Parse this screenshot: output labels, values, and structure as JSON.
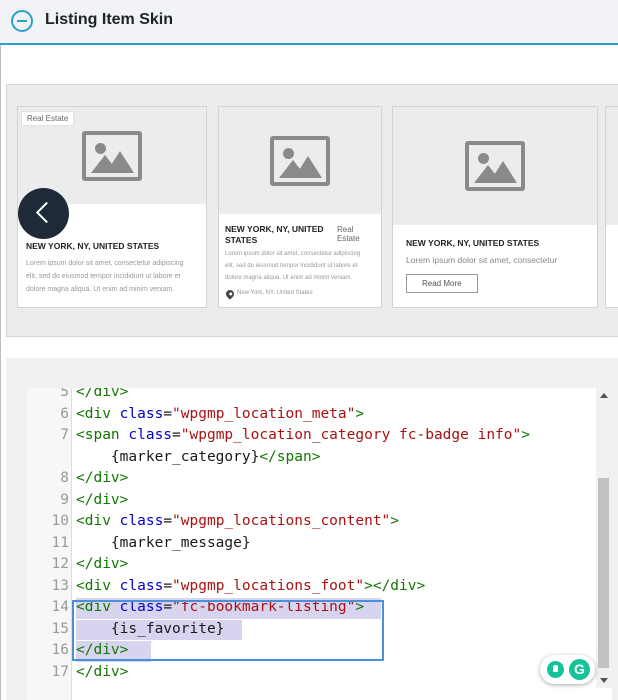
{
  "panel": {
    "title": "Listing Item Skin"
  },
  "cards": [
    {
      "badge": "Real Estate",
      "title": "NEW YORK, NY, UNITED STATES",
      "text": [
        "Lorem ipsum dolor sit amet, consectetur adipiscing",
        "elit, sed do eiusmod tempor incididunt ut labore et",
        "dolore magna aliqua. Ut enim ad minim veniam."
      ]
    },
    {
      "title_lines": [
        "NEW YORK, NY, UNITED",
        "STATES"
      ],
      "badge": "Real Estate",
      "text": [
        "Lorem ipsum dolor sit amet, consectetur adipiscing",
        "elit, sed do eiusmod tempor incididunt ut labore et",
        "dolore magna aliqua. Ut enim ad minim veniam."
      ],
      "location": "New York, NY, United States"
    },
    {
      "title": "NEW YORK, NY, UNITED STATES",
      "text": "Lorem ipsum dolor sit amet, consectetur",
      "button": "Read More"
    }
  ],
  "editor": {
    "lines": [
      {
        "num": "5",
        "tokens": [
          [
            "tag",
            "</div>"
          ]
        ]
      },
      {
        "num": "6",
        "tokens": [
          [
            "tag",
            "<div "
          ],
          [
            "attr",
            "class"
          ],
          [
            "txt",
            "="
          ],
          [
            "str",
            "\"wpgmp_location_meta\""
          ],
          [
            "tag",
            ">"
          ]
        ]
      },
      {
        "num": "7",
        "tokens": [
          [
            "tag",
            "<span "
          ],
          [
            "attr",
            "class"
          ],
          [
            "txt",
            "="
          ],
          [
            "str",
            "\"wpgmp_location_category fc-badge info\""
          ],
          [
            "tag",
            ">"
          ]
        ]
      },
      {
        "num": "",
        "tokens": [
          [
            "txt",
            "    {marker_category}"
          ],
          [
            "tag",
            "</span>"
          ]
        ]
      },
      {
        "num": "8",
        "tokens": [
          [
            "tag",
            "</div>"
          ]
        ]
      },
      {
        "num": "9",
        "tokens": [
          [
            "tag",
            "</div>"
          ]
        ]
      },
      {
        "num": "10",
        "tokens": [
          [
            "tag",
            "<div "
          ],
          [
            "attr",
            "class"
          ],
          [
            "txt",
            "="
          ],
          [
            "str",
            "\"wpgmp_locations_content\""
          ],
          [
            "tag",
            ">"
          ]
        ]
      },
      {
        "num": "11",
        "tokens": [
          [
            "txt",
            "    {marker_message}"
          ]
        ]
      },
      {
        "num": "12",
        "tokens": [
          [
            "tag",
            "</div>"
          ]
        ]
      },
      {
        "num": "13",
        "tokens": [
          [
            "tag",
            "<div "
          ],
          [
            "attr",
            "class"
          ],
          [
            "txt",
            "="
          ],
          [
            "str",
            "\"wpgmp_locations_foot\""
          ],
          [
            "tag",
            "></div>"
          ]
        ]
      },
      {
        "num": "14",
        "tokens": [
          [
            "tag",
            "<div "
          ],
          [
            "attr",
            "class"
          ],
          [
            "txt",
            "="
          ],
          [
            "str",
            "\"fc-bookmark-listing\""
          ],
          [
            "tag",
            ">"
          ]
        ]
      },
      {
        "num": "15",
        "tokens": [
          [
            "txt",
            "    {is_favorite}"
          ]
        ]
      },
      {
        "num": "16",
        "tokens": [
          [
            "tag",
            "</div>"
          ]
        ]
      },
      {
        "num": "17",
        "tokens": [
          [
            "tag",
            "</div>"
          ]
        ]
      }
    ]
  },
  "extension": {
    "grammarly_letter": "G"
  }
}
